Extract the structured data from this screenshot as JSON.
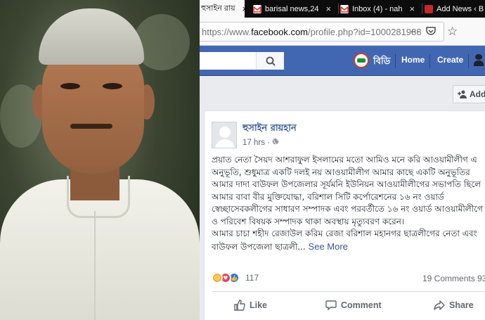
{
  "tabs": [
    {
      "label": "হুসাইন রায়",
      "active": true
    },
    {
      "label": "barisal news,24",
      "active": false
    },
    {
      "label": "Inbox (4) - nah",
      "active": false
    },
    {
      "label": "Add News ‹ B",
      "active": false
    }
  ],
  "url": {
    "prefix": "https://www.",
    "domain": "facebook.com",
    "path": "/profile.php?id=1000281988",
    "more": "···"
  },
  "facebook": {
    "search_icon": "search-icon",
    "profile_name": "বিডি",
    "nav": [
      "Home",
      "Create"
    ]
  },
  "add_friend": "Add I",
  "post": {
    "author": "হুসাইন রায়হান",
    "time": "17 hrs",
    "privacy": "·",
    "lines": [
      "প্রয়াত নেতা সৈয়দ আশরাফুল ইসলামের মতো আমিও মনে করি আওয়ামীলীগ এ",
      "অনুভূতি, শুধুমাত্র একটি দলই নয় আওয়ামীলীগ আমার কাছে একটি অনুভূতির",
      "আমার দাদা বাউফল উপজেলার সূর্যমনি ইউনিয়ন আওয়ামীলীগের সভাপতি ছিলে",
      "আমার বাবা বীর মুক্তিযোদ্ধা, বরিশাল সিটি কর্পোরেশনের ১৬ নং ওয়ার্ড",
      "স্বেচ্ছাসেবকলীগের সাধারণ সম্পাদক এবং পরবর্তীতে ১৬ নং ওয়ার্ড আওয়ামীলীগে",
      "ও পরিবেশ বিষয়ক সম্পাদক থাকা অবস্থায় মৃত্যুবরণ করেন।",
      "আমার চাচা শহীদ রেজাউল করিম রেজা বরিশাল মহানগর ছাত্রলীগের নেতা এবং"
    ],
    "last_line": "বাউফল উপজেলা ছাত্রলী...",
    "see_more": "See More",
    "reaction_count": "117",
    "comments": "19 Comments  93",
    "actions": {
      "like": "Like",
      "comment": "Comment",
      "share": "Share"
    }
  },
  "colors": {
    "fb_blue": "#4267b2",
    "link": "#385898"
  }
}
